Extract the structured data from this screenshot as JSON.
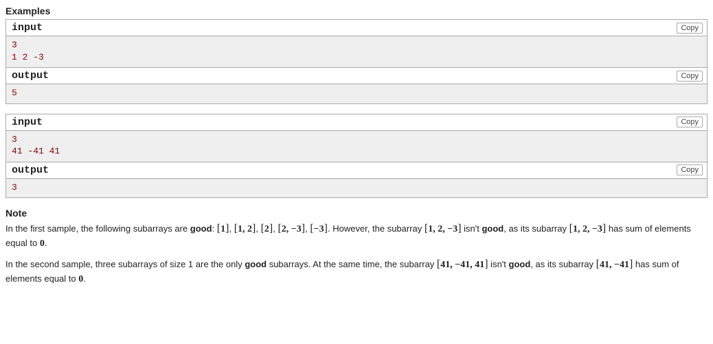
{
  "sections": {
    "examples_title": "Examples",
    "note_title": "Note"
  },
  "labels": {
    "input": "input",
    "output": "output",
    "copy": "Copy"
  },
  "examples": [
    {
      "input": "3\n1 2 -3",
      "output": "5"
    },
    {
      "input": "3\n41 -41 41",
      "output": "3"
    }
  ],
  "note": {
    "p1_a": "In the first sample, the following subarrays are ",
    "good": "good",
    "p1_b": ": ",
    "arr1": "1",
    "arr2": "1, 2",
    "arr3": "2",
    "arr4": "2, −3",
    "arr5": "−3",
    "p1_c": ". However, the subarray ",
    "arr6": "1, 2, −3",
    "p1_d": " isn't ",
    "p1_e": ", as its subarray ",
    "arr7": "1, 2, −3",
    "p1_f": " has sum of elements equal to ",
    "zero": "0",
    "p1_g": ".",
    "p2_a": "In the second sample, three subarrays of size 1 are the only ",
    "p2_b": " subarrays. At the same time, the subarray ",
    "arr8": "41, −41, 41",
    "p2_c": " isn't ",
    "p2_d": ", as its subarray ",
    "arr9": "41, −41",
    "p2_e": " has sum of elements equal to "
  }
}
